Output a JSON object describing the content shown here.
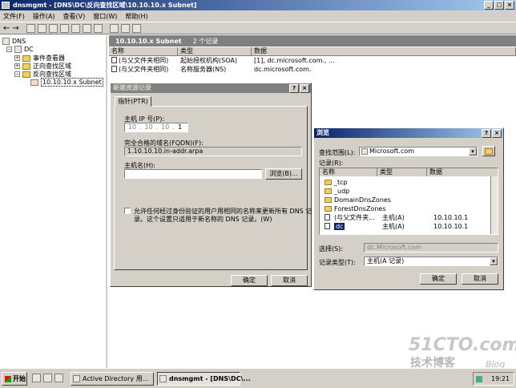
{
  "window": {
    "title": "dnsmgmt - [DNS\\DC\\反向查找区域\\10.10.10.x Subnet]",
    "title_btns": [
      "_",
      "□",
      "×"
    ]
  },
  "menu": [
    "文件(F)",
    "操作(A)",
    "查看(V)",
    "窗口(W)",
    "帮助(H)"
  ],
  "toolbar": {
    "back": "←",
    "forward": "→"
  },
  "tree": {
    "root": "DNS",
    "server": "DC",
    "items": [
      "事件查看器",
      "正向查找区域",
      "反向查找区域",
      "10.10.10.x Subnet"
    ]
  },
  "right_header": {
    "zone": "10.10.10.x Subnet",
    "count": "2 个记录"
  },
  "list": {
    "columns": [
      "名称",
      "类型",
      "数据"
    ],
    "rows": [
      [
        "(与父文件夹相同)",
        "起始授权机构(SOA)",
        "[1], dc.microsoft.com., ..."
      ],
      [
        "(与父文件夹相同)",
        "名称服务器(NS)",
        "dc.microsoft.com."
      ]
    ]
  },
  "new_record": {
    "title": "新建资源记录",
    "tab": "指针(PTR)",
    "host_ip_label": "主机 IP 号(P):",
    "ip_parts": [
      "10",
      "10",
      "10",
      "1"
    ],
    "fqdn_label": "完全合格的域名(FQDN)(F):",
    "fqdn_value": "1.10.10.10.in-addr.arpa",
    "hostname_label": "主机名(H):",
    "hostname_value": "",
    "browse_btn": "浏览(B)...",
    "checkbox_text_1": "允许任何经过身份验证的用户用相同的名称来更新所有 DNS 记",
    "checkbox_text_2": "录。这个设置只适用于新名称的 DNS 记录。(W)",
    "ok": "确定",
    "cancel": "取消"
  },
  "browse": {
    "title": "浏览",
    "scope_label": "查找范围(L):",
    "scope_value": "Microsoft.com",
    "records_label": "记录(R):",
    "columns": [
      "名称",
      "类型",
      "数据"
    ],
    "rows": [
      {
        "name": "_tcp",
        "type": "",
        "data": "",
        "icon": "folder"
      },
      {
        "name": "_udp",
        "type": "",
        "data": "",
        "icon": "folder"
      },
      {
        "name": "DomainDnsZones",
        "type": "",
        "data": "",
        "icon": "folder"
      },
      {
        "name": "ForestDnsZones",
        "type": "",
        "data": "",
        "icon": "folder"
      },
      {
        "name": "(与父文件夹...",
        "type": "主机(A)",
        "data": "10.10.10.1",
        "icon": "record"
      },
      {
        "name": "dc",
        "type": "主机(A)",
        "data": "10.10.10.1",
        "icon": "record"
      }
    ],
    "selection_label": "选择(S):",
    "selection_value": "dc.Microsoft.com",
    "record_type_label": "记录类型(T):",
    "record_type_value": "主机(A 记录)",
    "ok": "确定",
    "cancel": "取消"
  },
  "taskbar": {
    "start": "开始",
    "tasks": [
      "Active Directory 用...",
      "dnsmgmt - [DNS\\DC\\..."
    ],
    "clock": "19:21"
  },
  "watermark": {
    "brand": "51CTO.com",
    "sub": "技术博客",
    "blog": "Blog"
  }
}
